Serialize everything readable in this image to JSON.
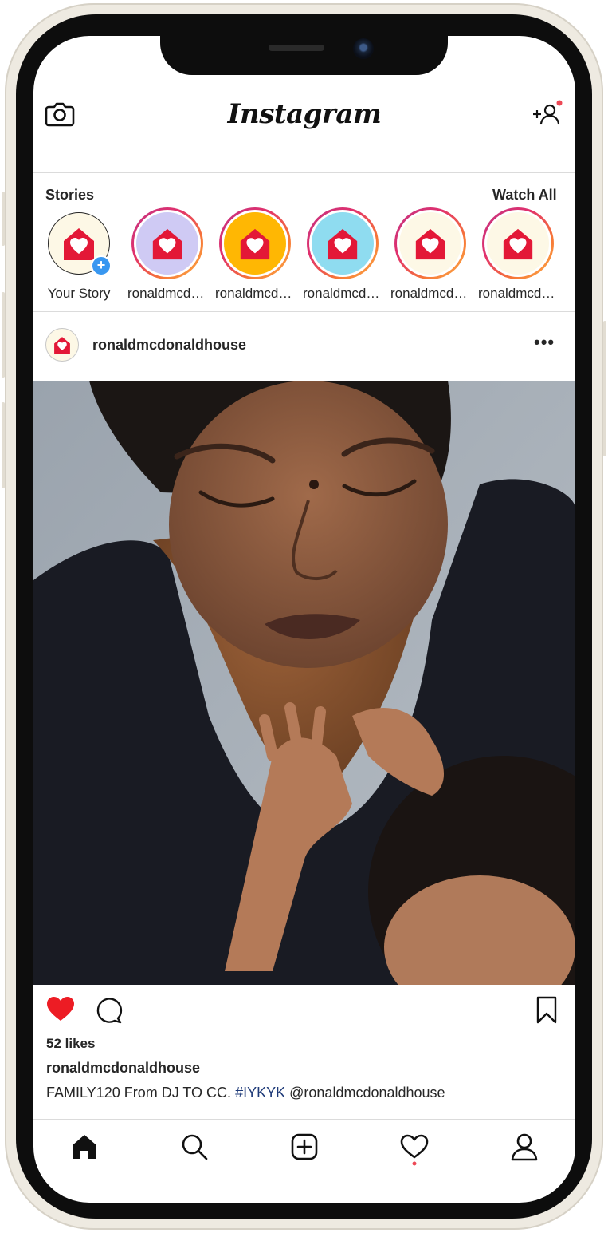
{
  "app": {
    "brand": "Instagram"
  },
  "top_bar": {
    "camera_icon": "camera-icon",
    "add_user_icon": "add-user-icon",
    "notification_dot_color": "#ed4956"
  },
  "stories": {
    "title": "Stories",
    "watch_all_label": "Watch All",
    "items": [
      {
        "label": "Your Story",
        "bg": "#fdf8e6",
        "own": true
      },
      {
        "label": "ronaldmcdonaldhouse",
        "bg": "#cfcaf4"
      },
      {
        "label": "ronaldmcdonaldhouse",
        "bg": "#ffb703"
      },
      {
        "label": "ronaldmcdonaldhouse",
        "bg": "#8fdcf0"
      },
      {
        "label": "ronaldmcdonaldhouse",
        "bg": "#fdf8e6"
      },
      {
        "label": "ronaldmcdonaldhouse",
        "bg": "#fdf8e6"
      }
    ]
  },
  "post": {
    "username": "ronaldmcdonaldhouse",
    "more_label": "•••",
    "image_description_icon": "photo",
    "likes": "52 likes",
    "caption_user": "ronaldmcdonaldhouse",
    "caption_text": "FAMILY120 From DJ TO CC.",
    "caption_hashtag": "#IYKYK",
    "caption_mention": "@ronaldmcdonaldhouse",
    "liked": true
  },
  "bottom_nav": {
    "items": [
      "home-icon",
      "search-icon",
      "new-post-icon",
      "activity-icon",
      "profile-icon"
    ]
  },
  "colors": {
    "brand_red": "#e31837",
    "like_red": "#ed1c24",
    "story_ring": "#e1306c",
    "badge_blue": "#3897f0"
  }
}
